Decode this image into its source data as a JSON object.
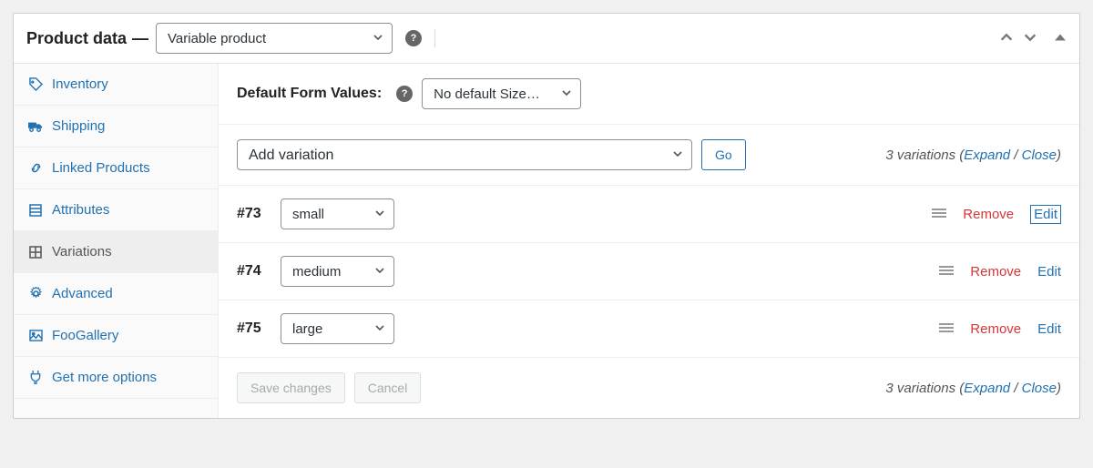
{
  "header": {
    "title": "Product data",
    "dash": "—",
    "product_type": "Variable product"
  },
  "sidebar": {
    "items": [
      {
        "label": "Inventory",
        "icon": "tag-icon"
      },
      {
        "label": "Shipping",
        "icon": "truck-icon"
      },
      {
        "label": "Linked Products",
        "icon": "link-icon"
      },
      {
        "label": "Attributes",
        "icon": "list-icon"
      },
      {
        "label": "Variations",
        "icon": "grid-icon"
      },
      {
        "label": "Advanced",
        "icon": "gear-icon"
      },
      {
        "label": "FooGallery",
        "icon": "image-icon"
      },
      {
        "label": "Get more options",
        "icon": "plug-icon"
      }
    ]
  },
  "defaults": {
    "label": "Default Form Values:",
    "selected": "No default Size…"
  },
  "variation_action": {
    "selected": "Add variation",
    "go": "Go"
  },
  "summary_top": {
    "count_text": "3 variations",
    "expand": "Expand",
    "slash": " / ",
    "close": "Close",
    "open": "(",
    "closeParen": ")"
  },
  "variations": [
    {
      "id": "#73",
      "attr": "small",
      "remove": "Remove",
      "edit": "Edit",
      "edit_boxed": true
    },
    {
      "id": "#74",
      "attr": "medium",
      "remove": "Remove",
      "edit": "Edit",
      "edit_boxed": false
    },
    {
      "id": "#75",
      "attr": "large",
      "remove": "Remove",
      "edit": "Edit",
      "edit_boxed": false
    }
  ],
  "footer": {
    "save": "Save changes",
    "cancel": "Cancel"
  },
  "summary_bottom": {
    "count_text": "3 variations",
    "expand": "Expand",
    "slash": " / ",
    "close": "Close",
    "open": "(",
    "closeParen": ")"
  }
}
